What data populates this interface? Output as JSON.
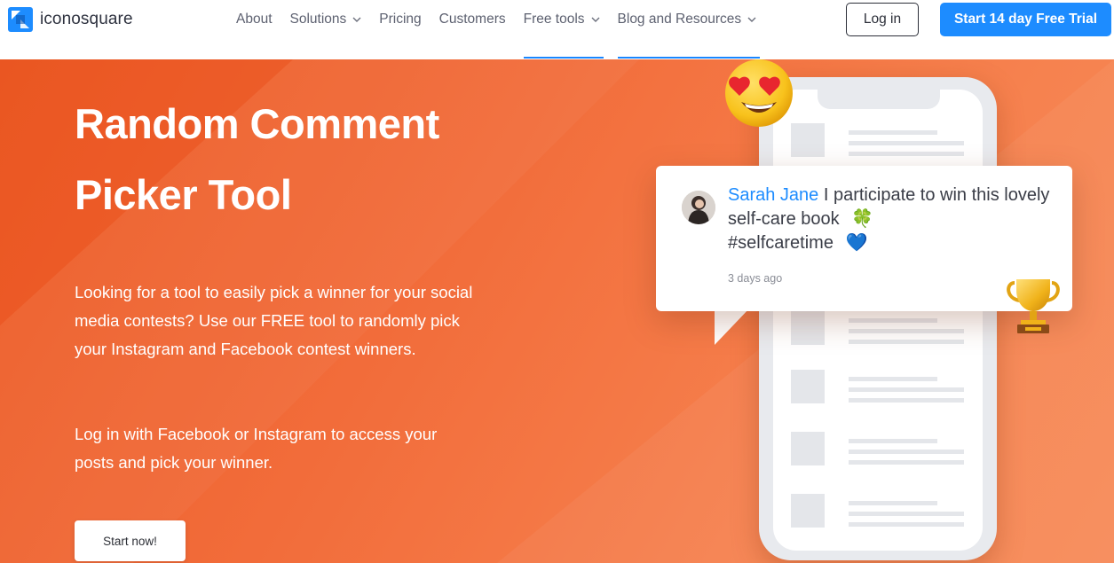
{
  "header": {
    "brand": "iconosquare",
    "nav": [
      {
        "label": "About",
        "has_dropdown": false
      },
      {
        "label": "Solutions",
        "has_dropdown": true
      },
      {
        "label": "Pricing",
        "has_dropdown": false
      },
      {
        "label": "Customers",
        "has_dropdown": false
      },
      {
        "label": "Free tools",
        "has_dropdown": true,
        "active": true
      },
      {
        "label": "Blog and Resources",
        "has_dropdown": true,
        "active": true
      }
    ],
    "login_label": "Log in",
    "trial_label": "Start 14 day Free Trial"
  },
  "hero": {
    "title": "Random Comment Picker Tool",
    "description": "Looking for a tool to easily pick a winner for your social media contests? Use our FREE tool to randomly pick your Instagram and Facebook contest winners.",
    "login_text": "Log in with Facebook or Instagram to access your posts and pick your winner.",
    "cta_label": "Start now!"
  },
  "comment": {
    "user": "Sarah Jane",
    "text": "I participate to win this lovely self-care book",
    "hashtag": "#selfcaretime",
    "emoji_1": "🍀",
    "emoji_2": "💙",
    "time": "3 days ago"
  },
  "colors": {
    "accent": "#1d8cff",
    "hero_orange": "#f26d3b",
    "text_dark": "#2f3340"
  },
  "icons": [
    "logo-mark-icon",
    "chevron-down-icon",
    "heart-eyes-emoji-icon",
    "trophy-icon",
    "avatar"
  ]
}
